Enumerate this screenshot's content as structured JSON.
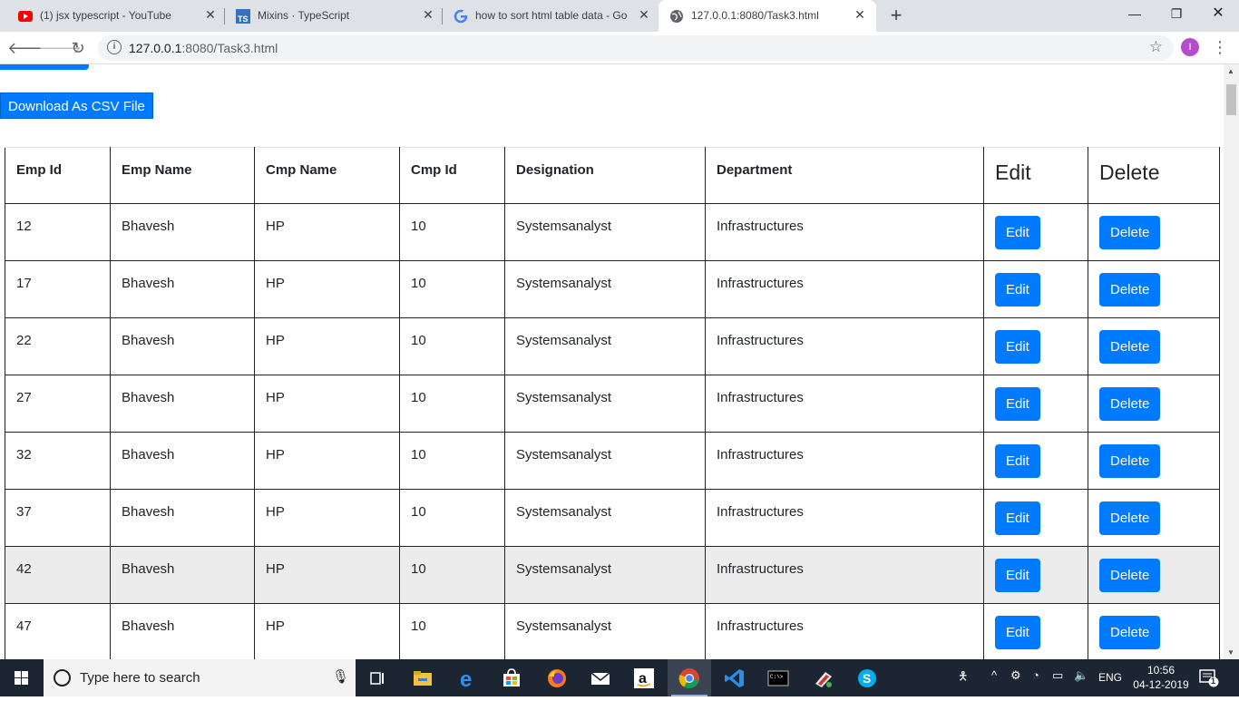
{
  "browser": {
    "tabs": [
      {
        "title": "(1) jsx typescript - YouTube",
        "favicon": "youtube-icon"
      },
      {
        "title": "Mixins · TypeScript",
        "favicon": "typescript-icon"
      },
      {
        "title": "how to sort html table data - Goo",
        "favicon": "google-icon"
      },
      {
        "title": "127.0.0.1:8080/Task3.html",
        "favicon": "globe-icon"
      }
    ],
    "active_tab": 3,
    "url_host": "127.0.0.1",
    "url_rest": ":8080/Task3.html",
    "profile_initial": "I"
  },
  "page": {
    "download_label": "Download As CSV File",
    "columns": [
      "Emp Id",
      "Emp Name",
      "Cmp Name",
      "Cmp Id",
      "Designation",
      "Department",
      "Edit",
      "Delete"
    ],
    "rows": [
      {
        "emp_id": "12",
        "emp_name": "Bhavesh",
        "cmp_name": "HP",
        "cmp_id": "10",
        "designation": "Systemsanalyst",
        "department": "Infrastructures"
      },
      {
        "emp_id": "17",
        "emp_name": "Bhavesh",
        "cmp_name": "HP",
        "cmp_id": "10",
        "designation": "Systemsanalyst",
        "department": "Infrastructures"
      },
      {
        "emp_id": "22",
        "emp_name": "Bhavesh",
        "cmp_name": "HP",
        "cmp_id": "10",
        "designation": "Systemsanalyst",
        "department": "Infrastructures"
      },
      {
        "emp_id": "27",
        "emp_name": "Bhavesh",
        "cmp_name": "HP",
        "cmp_id": "10",
        "designation": "Systemsanalyst",
        "department": "Infrastructures"
      },
      {
        "emp_id": "32",
        "emp_name": "Bhavesh",
        "cmp_name": "HP",
        "cmp_id": "10",
        "designation": "Systemsanalyst",
        "department": "Infrastructures"
      },
      {
        "emp_id": "37",
        "emp_name": "Bhavesh",
        "cmp_name": "HP",
        "cmp_id": "10",
        "designation": "Systemsanalyst",
        "department": "Infrastructures"
      },
      {
        "emp_id": "42",
        "emp_name": "Bhavesh",
        "cmp_name": "HP",
        "cmp_id": "10",
        "designation": "Systemsanalyst",
        "department": "Infrastructures"
      },
      {
        "emp_id": "47",
        "emp_name": "Bhavesh",
        "cmp_name": "HP",
        "cmp_id": "10",
        "designation": "Systemsanalyst",
        "department": "Infrastructures"
      }
    ],
    "highlighted_row": 6,
    "edit_label": "Edit",
    "delete_label": "Delete",
    "accent": "#007bff"
  },
  "taskbar": {
    "search_placeholder": "Type here to search",
    "language": "ENG",
    "time": "10:56",
    "date": "04-12-2019",
    "notification_count": "1",
    "pinned": [
      "task-view-icon",
      "file-explorer-icon",
      "edge-icon",
      "store-icon",
      "firefox-icon",
      "mail-icon",
      "amazon-icon",
      "chrome-icon",
      "vscode-icon",
      "terminal-icon",
      "paint-icon",
      "skype-icon"
    ]
  }
}
